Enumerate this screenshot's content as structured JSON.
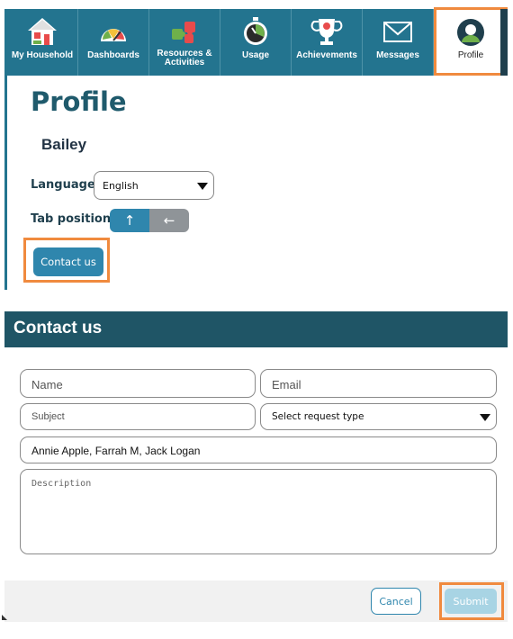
{
  "nav": {
    "items": [
      {
        "label": "My Household",
        "icon": "house-icon"
      },
      {
        "label": "Dashboards",
        "icon": "gauge-icon"
      },
      {
        "label": "Resources & Activities",
        "icon": "puzzle-icon"
      },
      {
        "label": "Usage",
        "icon": "stopwatch-icon"
      },
      {
        "label": "Achievements",
        "icon": "trophy-icon"
      },
      {
        "label": "Messages",
        "icon": "envelope-icon"
      },
      {
        "label": "Profile",
        "icon": "user-avatar-icon"
      }
    ],
    "active": "Profile"
  },
  "profile": {
    "title": "Profile",
    "username": "Bailey",
    "language_label": "Language:",
    "language_value": "English",
    "tab_position_label": "Tab position:",
    "contact_button": "Contact us"
  },
  "contact_form": {
    "title": "Contact us",
    "name_placeholder": "Name",
    "email_placeholder": "Email",
    "subject_placeholder": "Subject",
    "request_type_placeholder": "Select request type",
    "recipients_value": "Annie Apple, Farrah M, Jack Logan",
    "description_placeholder": "Description",
    "cancel_label": "Cancel",
    "submit_label": "Submit"
  },
  "colors": {
    "nav_bg": "#23748f",
    "header_bg": "#1f5566",
    "accent": "#2f86ad",
    "highlight": "#f08a3e",
    "submit_disabled": "#a8d4e4"
  }
}
